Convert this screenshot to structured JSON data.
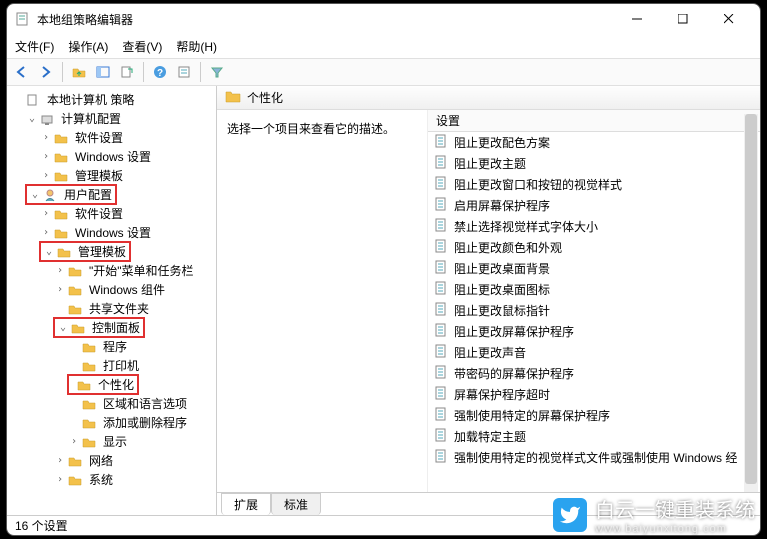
{
  "window": {
    "title": "本地组策略编辑器",
    "min": "—",
    "max": "□",
    "close": "✕"
  },
  "menu": {
    "file": "文件(F)",
    "action": "操作(A)",
    "view": "查看(V)",
    "help": "帮助(H)"
  },
  "tree": {
    "root": "本地计算机 策略",
    "computer": "计算机配置",
    "c_soft": "软件设置",
    "c_win": "Windows 设置",
    "c_admin": "管理模板",
    "user": "用户配置",
    "u_soft": "软件设置",
    "u_win": "Windows 设置",
    "u_admin": "管理模板",
    "startmenu": "\"开始\"菜单和任务栏",
    "wincomp": "Windows 组件",
    "shared": "共享文件夹",
    "cpl": "控制面板",
    "programs": "程序",
    "printers": "打印机",
    "personalization": "个性化",
    "region": "区域和语言选项",
    "addremove": "添加或删除程序",
    "display": "显示",
    "network": "网络",
    "system": "系统"
  },
  "header": {
    "title": "个性化"
  },
  "desc": "选择一个项目来查看它的描述。",
  "listhead": "设置",
  "items": [
    "阻止更改配色方案",
    "阻止更改主题",
    "阻止更改窗口和按钮的视觉样式",
    "启用屏幕保护程序",
    "禁止选择视觉样式字体大小",
    "阻止更改颜色和外观",
    "阻止更改桌面背景",
    "阻止更改桌面图标",
    "阻止更改鼠标指针",
    "阻止更改屏幕保护程序",
    "阻止更改声音",
    "带密码的屏幕保护程序",
    "屏幕保护程序超时",
    "强制使用特定的屏幕保护程序",
    "加载特定主题",
    "强制使用特定的视觉样式文件或强制使用 Windows 经"
  ],
  "tabs": {
    "extended": "扩展",
    "standard": "标准"
  },
  "status": "16 个设置",
  "watermark": {
    "brand": "白云一键重装系统",
    "url": "www.baiyunxitong.com"
  }
}
